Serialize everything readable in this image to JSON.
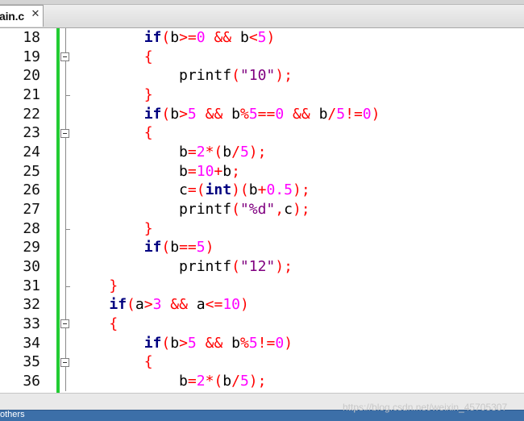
{
  "tab": {
    "label": "ain.c",
    "close": "✕"
  },
  "editor": {
    "lines": [
      {
        "no": "18",
        "tokens": [
          {
            "t": "        "
          },
          {
            "t": "if",
            "c": "kw"
          },
          {
            "t": "(",
            "c": "op"
          },
          {
            "t": "b",
            "c": "pl"
          },
          {
            "t": ">=",
            "c": "op"
          },
          {
            "t": "0",
            "c": "nm"
          },
          {
            "t": " ",
            "c": "pl"
          },
          {
            "t": "&&",
            "c": "op"
          },
          {
            "t": " b",
            "c": "pl"
          },
          {
            "t": "<",
            "c": "op"
          },
          {
            "t": "5",
            "c": "nm"
          },
          {
            "t": ")",
            "c": "op"
          }
        ]
      },
      {
        "no": "19",
        "tokens": [
          {
            "t": "        "
          },
          {
            "t": "{",
            "c": "op"
          }
        ]
      },
      {
        "no": "20",
        "tokens": [
          {
            "t": "            "
          },
          {
            "t": "printf",
            "c": "pl"
          },
          {
            "t": "(",
            "c": "op"
          },
          {
            "t": "\"10\"",
            "c": "st"
          },
          {
            "t": ");",
            "c": "op"
          }
        ]
      },
      {
        "no": "21",
        "tokens": [
          {
            "t": "        "
          },
          {
            "t": "}",
            "c": "op"
          }
        ]
      },
      {
        "no": "22",
        "tokens": [
          {
            "t": "        "
          },
          {
            "t": "if",
            "c": "kw"
          },
          {
            "t": "(",
            "c": "op"
          },
          {
            "t": "b",
            "c": "pl"
          },
          {
            "t": ">",
            "c": "op"
          },
          {
            "t": "5",
            "c": "nm"
          },
          {
            "t": " ",
            "c": "pl"
          },
          {
            "t": "&&",
            "c": "op"
          },
          {
            "t": " b",
            "c": "pl"
          },
          {
            "t": "%",
            "c": "op"
          },
          {
            "t": "5",
            "c": "nm"
          },
          {
            "t": "==",
            "c": "op"
          },
          {
            "t": "0",
            "c": "nm"
          },
          {
            "t": " ",
            "c": "pl"
          },
          {
            "t": "&&",
            "c": "op"
          },
          {
            "t": " b",
            "c": "pl"
          },
          {
            "t": "/",
            "c": "op"
          },
          {
            "t": "5",
            "c": "nm"
          },
          {
            "t": "!=",
            "c": "op"
          },
          {
            "t": "0",
            "c": "nm"
          },
          {
            "t": ")",
            "c": "op"
          }
        ]
      },
      {
        "no": "23",
        "tokens": [
          {
            "t": "        "
          },
          {
            "t": "{",
            "c": "op"
          }
        ]
      },
      {
        "no": "24",
        "tokens": [
          {
            "t": "            "
          },
          {
            "t": "b",
            "c": "pl"
          },
          {
            "t": "=",
            "c": "op"
          },
          {
            "t": "2",
            "c": "nm"
          },
          {
            "t": "*(",
            "c": "op"
          },
          {
            "t": "b",
            "c": "pl"
          },
          {
            "t": "/",
            "c": "op"
          },
          {
            "t": "5",
            "c": "nm"
          },
          {
            "t": ");",
            "c": "op"
          }
        ]
      },
      {
        "no": "25",
        "tokens": [
          {
            "t": "            "
          },
          {
            "t": "b",
            "c": "pl"
          },
          {
            "t": "=",
            "c": "op"
          },
          {
            "t": "10",
            "c": "nm"
          },
          {
            "t": "+",
            "c": "op"
          },
          {
            "t": "b",
            "c": "pl"
          },
          {
            "t": ";",
            "c": "op"
          }
        ]
      },
      {
        "no": "26",
        "tokens": [
          {
            "t": "            "
          },
          {
            "t": "c",
            "c": "pl"
          },
          {
            "t": "=(",
            "c": "op"
          },
          {
            "t": "int",
            "c": "kw"
          },
          {
            "t": ")(",
            "c": "op"
          },
          {
            "t": "b",
            "c": "pl"
          },
          {
            "t": "+",
            "c": "op"
          },
          {
            "t": "0.5",
            "c": "nm"
          },
          {
            "t": ");",
            "c": "op"
          }
        ]
      },
      {
        "no": "27",
        "tokens": [
          {
            "t": "            "
          },
          {
            "t": "printf",
            "c": "pl"
          },
          {
            "t": "(",
            "c": "op"
          },
          {
            "t": "\"%d\"",
            "c": "st"
          },
          {
            "t": ",",
            "c": "op"
          },
          {
            "t": "c",
            "c": "pl"
          },
          {
            "t": ");",
            "c": "op"
          }
        ]
      },
      {
        "no": "28",
        "tokens": [
          {
            "t": "        "
          },
          {
            "t": "}",
            "c": "op"
          }
        ]
      },
      {
        "no": "29",
        "tokens": [
          {
            "t": "        "
          },
          {
            "t": "if",
            "c": "kw"
          },
          {
            "t": "(",
            "c": "op"
          },
          {
            "t": "b",
            "c": "pl"
          },
          {
            "t": "==",
            "c": "op"
          },
          {
            "t": "5",
            "c": "nm"
          },
          {
            "t": ")",
            "c": "op"
          }
        ]
      },
      {
        "no": "30",
        "tokens": [
          {
            "t": "            "
          },
          {
            "t": "printf",
            "c": "pl"
          },
          {
            "t": "(",
            "c": "op"
          },
          {
            "t": "\"12\"",
            "c": "st"
          },
          {
            "t": ");",
            "c": "op"
          }
        ]
      },
      {
        "no": "31",
        "tokens": [
          {
            "t": "    "
          },
          {
            "t": "}",
            "c": "op"
          }
        ]
      },
      {
        "no": "32",
        "tokens": [
          {
            "t": "    "
          },
          {
            "t": "if",
            "c": "kw"
          },
          {
            "t": "(",
            "c": "op"
          },
          {
            "t": "a",
            "c": "pl"
          },
          {
            "t": ">",
            "c": "op"
          },
          {
            "t": "3",
            "c": "nm"
          },
          {
            "t": " ",
            "c": "pl"
          },
          {
            "t": "&&",
            "c": "op"
          },
          {
            "t": " a",
            "c": "pl"
          },
          {
            "t": "<=",
            "c": "op"
          },
          {
            "t": "10",
            "c": "nm"
          },
          {
            "t": ")",
            "c": "op"
          }
        ]
      },
      {
        "no": "33",
        "tokens": [
          {
            "t": "    "
          },
          {
            "t": "{",
            "c": "op"
          }
        ]
      },
      {
        "no": "34",
        "tokens": [
          {
            "t": "        "
          },
          {
            "t": "if",
            "c": "kw"
          },
          {
            "t": "(",
            "c": "op"
          },
          {
            "t": "b",
            "c": "pl"
          },
          {
            "t": ">",
            "c": "op"
          },
          {
            "t": "5",
            "c": "nm"
          },
          {
            "t": " ",
            "c": "pl"
          },
          {
            "t": "&&",
            "c": "op"
          },
          {
            "t": " b",
            "c": "pl"
          },
          {
            "t": "%",
            "c": "op"
          },
          {
            "t": "5",
            "c": "nm"
          },
          {
            "t": "!=",
            "c": "op"
          },
          {
            "t": "0",
            "c": "nm"
          },
          {
            "t": ")",
            "c": "op"
          }
        ]
      },
      {
        "no": "35",
        "tokens": [
          {
            "t": "        "
          },
          {
            "t": "{",
            "c": "op"
          }
        ]
      },
      {
        "no": "36",
        "tokens": [
          {
            "t": "            "
          },
          {
            "t": "b",
            "c": "pl"
          },
          {
            "t": "=",
            "c": "op"
          },
          {
            "t": "2",
            "c": "nm"
          },
          {
            "t": "*(",
            "c": "op"
          },
          {
            "t": "b",
            "c": "pl"
          },
          {
            "t": "/",
            "c": "op"
          },
          {
            "t": "5",
            "c": "nm"
          },
          {
            "t": ");",
            "c": "op"
          }
        ]
      }
    ],
    "fold": {
      "open_lines": [
        "19",
        "23",
        "33",
        "35"
      ],
      "end_lines": [
        "21",
        "28",
        "31"
      ]
    },
    "colors": {
      "keyword": "#000080",
      "operator": "#ff0000",
      "number": "#ff00ff",
      "string": "#800080",
      "change_bar": "#22cc33"
    }
  },
  "status": {
    "text": "others"
  },
  "watermark": "https://blog.csdn.net/weixin_45705307"
}
